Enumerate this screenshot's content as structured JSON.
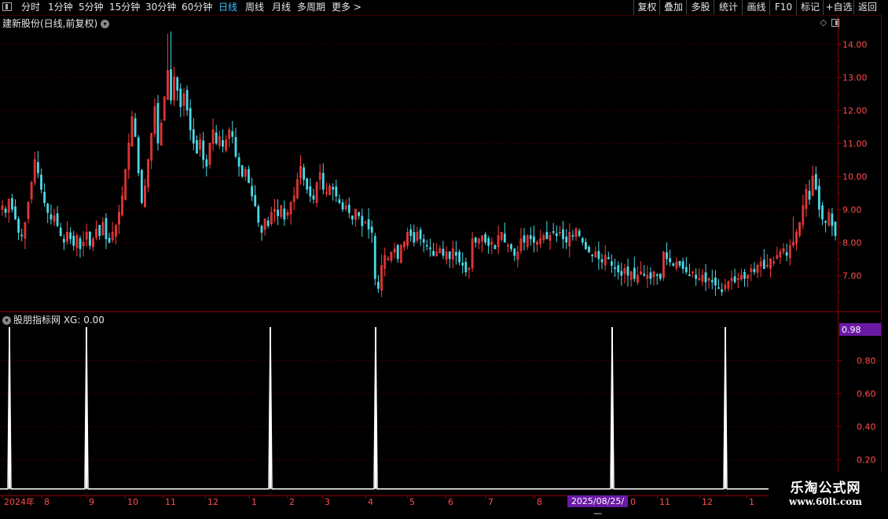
{
  "toolbar": {
    "periods": [
      "分时",
      "1分钟",
      "5分钟",
      "15分钟",
      "30分钟",
      "60分钟",
      "日线",
      "周线",
      "月线",
      "多周期",
      "更多 >"
    ],
    "active_period": "日线",
    "actions": [
      "复权",
      "叠加",
      "多股",
      "统计",
      "画线",
      "F10",
      "标记",
      "+自选",
      "返回"
    ]
  },
  "chart": {
    "title": "建新股份(日线,前复权)",
    "price_axis": [
      "14.00",
      "13.00",
      "12.00",
      "11.00",
      "10.00",
      "9.00",
      "8.00",
      "7.00"
    ],
    "indicator_title": "股朋指标网  XG: 0.00",
    "indicator_axis": [
      "0.80",
      "0.60",
      "0.40",
      "0.20"
    ],
    "indicator_value_label": "0.98",
    "time_axis": [
      "2024年",
      "8",
      "9",
      "10",
      "11",
      "12",
      "1",
      "2",
      "3",
      "4",
      "5",
      "6",
      "7",
      "8",
      "0",
      "11",
      "12",
      "1"
    ],
    "cursor_date": "2025/08/25/—",
    "colors": {
      "up": "#ff3c3c",
      "down": "#4ad9e6",
      "grid": "#5a0000",
      "signal": "#ffffff",
      "highlight": "#6a1ba5"
    }
  },
  "chart_data": {
    "type": "candlestick",
    "ylim": [
      6.0,
      14.5
    ],
    "closes": [
      9.1,
      8.9,
      9.3,
      9.0,
      8.7,
      8.3,
      8.2,
      8.6,
      9.2,
      9.8,
      10.5,
      10.1,
      9.6,
      9.2,
      8.9,
      8.7,
      8.8,
      8.5,
      8.2,
      8.0,
      8.3,
      8.1,
      7.9,
      8.2,
      7.8,
      8.0,
      8.3,
      7.9,
      8.1,
      8.4,
      8.2,
      8.6,
      8.1,
      8.0,
      8.3,
      8.5,
      8.9,
      9.4,
      10.2,
      11.0,
      11.8,
      11.2,
      10.1,
      9.2,
      9.7,
      10.5,
      11.3,
      12.1,
      11.0,
      11.6,
      12.4,
      13.2,
      12.3,
      13.0,
      12.6,
      12.1,
      12.5,
      12.0,
      11.4,
      11.0,
      10.7,
      11.1,
      10.5,
      10.3,
      11.0,
      11.4,
      11.0,
      11.2,
      10.9,
      11.1,
      11.4,
      11.2,
      10.6,
      10.3,
      10.0,
      10.2,
      9.8,
      9.4,
      9.1,
      8.6,
      8.3,
      8.7,
      8.5,
      8.9,
      9.0,
      8.8,
      9.1,
      8.7,
      8.9,
      9.2,
      9.4,
      9.9,
      10.3,
      9.9,
      9.6,
      9.4,
      9.3,
      9.8,
      10.1,
      9.6,
      9.5,
      9.7,
      9.6,
      9.4,
      9.2,
      9.0,
      9.1,
      8.9,
      8.7,
      9.0,
      8.8,
      8.5,
      8.6,
      8.4,
      8.3,
      6.9,
      6.6,
      7.3,
      7.6,
      7.5,
      7.7,
      7.8,
      7.5,
      7.9,
      8.0,
      8.3,
      8.2,
      8.0,
      8.3,
      8.1,
      8.0,
      7.9,
      7.8,
      7.6,
      7.7,
      7.8,
      7.6,
      7.7,
      7.5,
      7.8,
      7.6,
      7.4,
      7.3,
      7.1,
      7.2,
      8.1,
      8.0,
      8.1,
      8.2,
      8.0,
      7.9,
      8.0,
      7.8,
      8.2,
      8.3,
      8.0,
      7.9,
      7.8,
      7.6,
      7.7,
      8.1,
      8.0,
      8.2,
      8.1,
      8.0,
      8.0,
      8.1,
      8.2,
      8.1,
      8.2,
      8.3,
      8.2,
      8.3,
      8.1,
      8.0,
      8.3,
      8.2,
      8.4,
      8.2,
      8.0,
      7.8,
      7.7,
      7.6,
      7.7,
      7.5,
      7.4,
      7.6,
      7.5,
      7.3,
      7.2,
      7.1,
      7.0,
      7.2,
      7.0,
      7.1,
      6.9,
      7.0,
      7.1,
      7.0,
      7.0,
      6.9,
      7.1,
      7.0,
      6.9,
      7.7,
      7.5,
      7.4,
      7.3,
      7.4,
      7.3,
      7.2,
      7.1,
      7.0,
      7.1,
      6.9,
      6.9,
      7.0,
      6.8,
      6.9,
      6.8,
      6.7,
      6.6,
      6.5,
      6.7,
      6.8,
      6.9,
      6.8,
      6.9,
      7.0,
      6.9,
      7.0,
      7.2,
      7.1,
      7.3,
      7.4,
      7.2,
      7.3,
      7.5,
      7.4,
      7.6,
      7.7,
      7.8,
      7.6,
      7.9,
      8.0,
      8.3,
      8.6,
      9.1,
      9.6,
      9.3,
      10.0,
      9.6,
      9.0,
      8.7,
      8.6,
      8.9,
      8.5,
      8.2
    ],
    "signals": [
      4,
      39,
      123,
      171,
      285,
      338
    ],
    "indicator_ylim": [
      0,
      1.0
    ]
  }
}
